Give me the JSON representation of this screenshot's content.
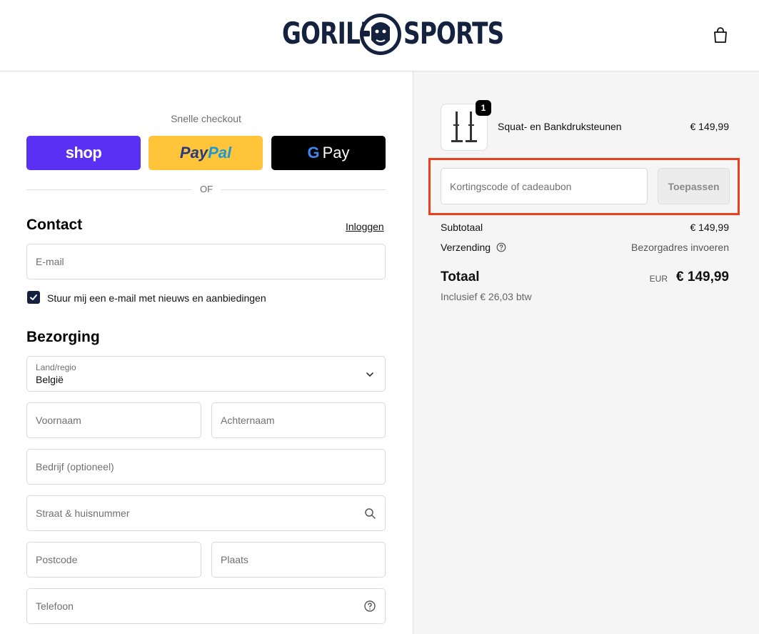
{
  "header": {
    "logo_left": "GORILLA",
    "logo_right": "SPORTS",
    "brand_color": "#14223f",
    "cart_icon": "shopping-bag-icon"
  },
  "express_checkout": {
    "title": "Snelle checkout",
    "shop_label": "shop",
    "paypal_label_1": "Pay",
    "paypal_label_2": "Pal",
    "gpay_g": "G",
    "gpay_label": "Pay",
    "divider_text": "OF"
  },
  "contact": {
    "title": "Contact",
    "login_link": "Inloggen",
    "email_placeholder": "E-mail",
    "newsletter_label": "Stuur mij een e-mail met nieuws en aanbiedingen",
    "newsletter_checked": true
  },
  "delivery": {
    "title": "Bezorging",
    "country_label": "Land/regio",
    "country_value": "België",
    "first_name_placeholder": "Voornaam",
    "last_name_placeholder": "Achternaam",
    "company_placeholder": "Bedrijf (optioneel)",
    "street_placeholder": "Straat & huisnummer",
    "postcode_placeholder": "Postcode",
    "city_placeholder": "Plaats",
    "phone_placeholder": "Telefoon"
  },
  "order": {
    "item": {
      "quantity": "1",
      "name": "Squat- en Bankdruksteunen",
      "price": "€ 149,99"
    },
    "discount_placeholder": "Kortingscode of cadeaubon",
    "apply_label": "Toepassen",
    "subtotal_label": "Subtotaal",
    "subtotal_value": "€ 149,99",
    "shipping_label": "Verzending",
    "shipping_value": "Bezorgadres invoeren",
    "total_label": "Totaal",
    "total_currency": "EUR",
    "total_value": "€ 149,99",
    "tax_note": "Inclusief € 26,03 btw"
  },
  "colors": {
    "highlight": "#e8401c",
    "shop_pay": "#5a31f4",
    "paypal": "#ffc439",
    "gpay": "#000000"
  }
}
